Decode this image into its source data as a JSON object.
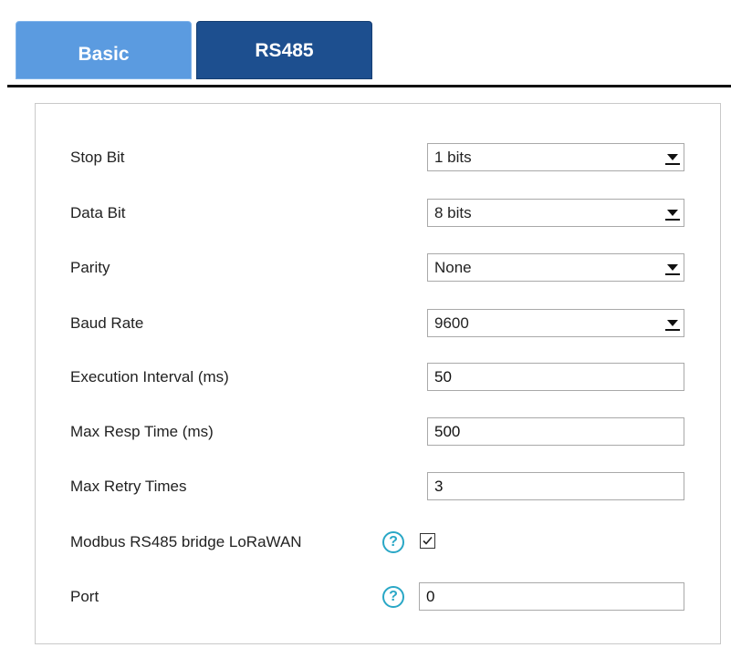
{
  "tabs": [
    {
      "label": "Basic"
    },
    {
      "label": "RS485"
    }
  ],
  "form": {
    "stop_bit": {
      "label": "Stop Bit",
      "value": "1 bits"
    },
    "data_bit": {
      "label": "Data Bit",
      "value": "8 bits"
    },
    "parity": {
      "label": "Parity",
      "value": "None"
    },
    "baud_rate": {
      "label": "Baud Rate",
      "value": "9600"
    },
    "execution_interval": {
      "label": "Execution Interval (ms)",
      "value": "50"
    },
    "max_resp_time": {
      "label": "Max Resp Time (ms)",
      "value": "500"
    },
    "max_retry_times": {
      "label": "Max Retry Times",
      "value": "3"
    },
    "bridge": {
      "label": "Modbus RS485 bridge LoRaWAN",
      "help": "?",
      "checked": true
    },
    "port": {
      "label": "Port",
      "help": "?",
      "value": "0"
    }
  },
  "icons": {
    "help": "question-circle-icon",
    "dropdown": "chevron-down-icon",
    "check": "checkmark-icon"
  },
  "colors": {
    "tab_basic": "#5b9be0",
    "tab_active": "#1d4f8f",
    "help_icon": "#29a7c6"
  }
}
